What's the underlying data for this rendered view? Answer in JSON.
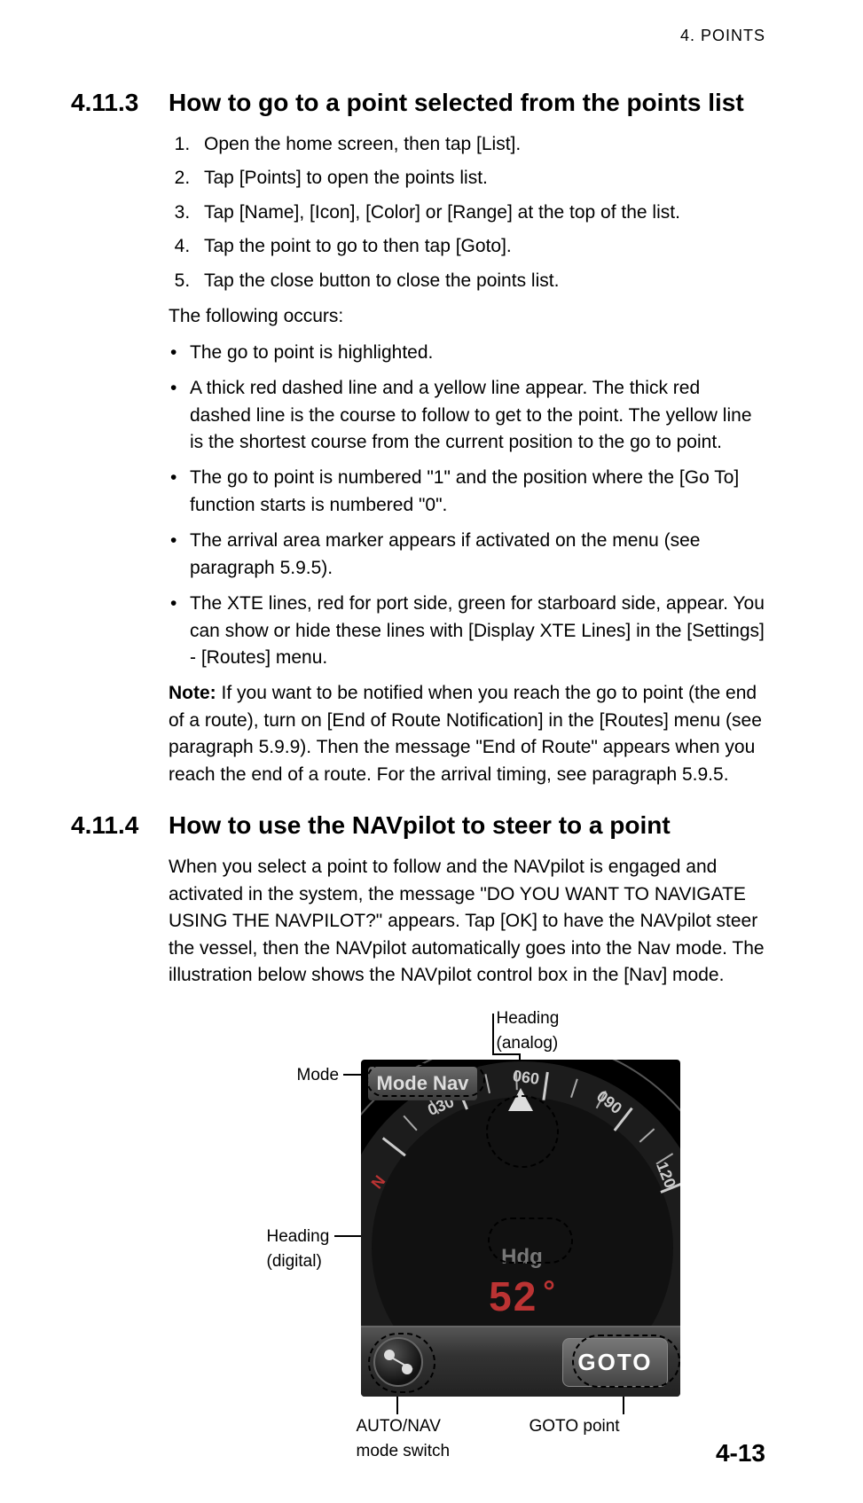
{
  "running_head": "4.  POINTS",
  "page_number": "4-13",
  "sec1": {
    "num": "4.11.3",
    "title": "How to go to a point selected from the points list",
    "steps": [
      "Open the home screen, then tap [List].",
      "Tap [Points] to open the points list.",
      "Tap [Name], [Icon], [Color] or [Range] at the top of the list.",
      "Tap the point to go to then tap [Goto].",
      "Tap the close button to close the points list."
    ],
    "following": "The following occurs:",
    "bullets": [
      "The go to point is highlighted.",
      " A thick red dashed line and a yellow line appear. The thick red dashed line is the course to follow to get to the point. The yellow line is the shortest course from the current position to the go to point.",
      "The go to point is numbered \"1\" and the position where the [Go To] function starts is numbered \"0\".",
      "The arrival area marker appears if activated on the menu (see paragraph 5.9.5).",
      "The XTE lines, red for port side, green for starboard side, appear. You can show or hide these lines with [Display XTE Lines] in the [Settings] - [Routes] menu."
    ],
    "note_label": "Note:",
    "note_text": " If you want to be notified when you reach the go to point (the end of a route), turn on [End of Route Notification] in the [Routes] menu (see paragraph 5.9.9). Then the message \"End of Route\" appears when you reach the end of a route. For the arrival timing, see paragraph 5.9.5."
  },
  "sec2": {
    "num": "4.11.4",
    "title": "How to use the NAVpilot to steer to a point",
    "para": "When you select a point to follow and the NAVpilot is engaged and activated in the system, the message \"DO YOU WANT TO NAVIGATE USING THE NAVPILOT?\" appears. Tap [OK] to have the NAVpilot steer the vessel, then the NAVpilot automatically goes into the Nav mode. The illustration below shows the NAVpilot control box in the [Nav] mode."
  },
  "figure": {
    "labels": {
      "heading_analog_1": "Heading",
      "heading_analog_2": "(analog)",
      "mode": "Mode",
      "heading_digital_1": "Heading",
      "heading_digital_2": "(digital)",
      "auto_nav_1": "AUTO/NAV",
      "auto_nav_2": "mode switch",
      "goto_point": "GOTO point"
    },
    "navpilot": {
      "mode_text": "Mode Nav",
      "hdg_label": "Hdg",
      "hdg_value": "52",
      "hdg_unit": "°",
      "goto_button": "GOTO",
      "ring_numbers": {
        "n": "N",
        "d030": "030",
        "d060": "060",
        "d090": "090",
        "d120": "120"
      }
    }
  }
}
